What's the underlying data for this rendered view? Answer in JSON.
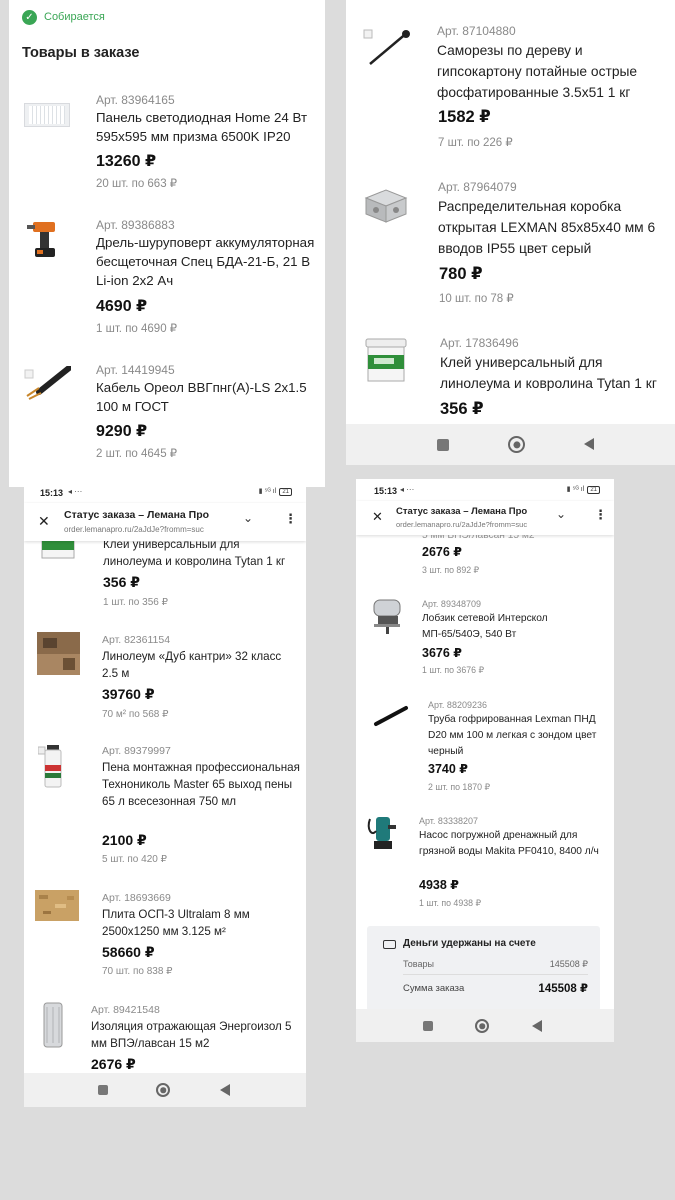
{
  "p1": {
    "status": "Собирается",
    "section_title": "Товары в заказе",
    "items": [
      {
        "art": "Арт. 83964165",
        "name": "Панель светодиодная Home 24 Вт 595x595 мм призма 6500K IP20",
        "price": "13260 ₽",
        "qty": "20 шт. по 663 ₽"
      },
      {
        "art": "Арт. 89386883",
        "name": "Дрель-шуруповерт аккумуляторная бесщеточная Спец БДА-21-Б, 21 В Li-ion 2x2 Ач",
        "price": "4690 ₽",
        "qty": "1 шт. по 4690 ₽"
      },
      {
        "art": "Арт. 14419945",
        "name": "Кабель Ореол ВВГпнг(А)-LS 2x1.5 100 м ГОСТ",
        "price": "9290 ₽",
        "qty": "2 шт. по 4645 ₽"
      }
    ]
  },
  "p2": {
    "items": [
      {
        "art": "Арт. 87104880",
        "name": "Саморезы по дереву и гипсокартону потайные острые фосфатированные 3.5x51 1 кг",
        "price": "1582 ₽",
        "qty": "7 шт. по 226 ₽"
      },
      {
        "art": "Арт. 87964079",
        "name": "Распределительная коробка открытая LEXMAN 85x85x40 мм 6 вводов IP55 цвет серый",
        "price": "780 ₽",
        "qty": "10 шт. по 78 ₽"
      },
      {
        "art": "Арт. 17836496",
        "name": "Клей универсальный для линолеума и ковролина Tytan 1 кг",
        "price": "356 ₽",
        "qty": ""
      }
    ]
  },
  "browser": {
    "time": "15:13",
    "status_icons": "◂ ···",
    "signal": "▮ ⁵ᴳ ıl",
    "battery": "21",
    "title": "Статус заказа – Лемана Про",
    "url": "order.lemanapro.ru/2aJdJe?fromm=suc"
  },
  "p3": {
    "top_name": "Клей универсальный для линолеума и ковролина Tytan 1 кг",
    "top_price": "356 ₽",
    "top_qty": "1 шт. по 356 ₽",
    "items": [
      {
        "art": "Арт. 82361154",
        "name": "Линолеум «Дуб кантри» 32 класс 2.5 м",
        "price": "39760 ₽",
        "qty": "70 м² по 568 ₽"
      },
      {
        "art": "Арт. 89379997",
        "name": "Пена монтажная профессиональная Технониколь Master 65 выход пены 65 л всесезонная 750 мл",
        "price": "2100 ₽",
        "qty": "5 шт. по 420 ₽"
      },
      {
        "art": "Арт. 18693669",
        "name": "Плита ОСП-3 Ultralam 8 мм 2500x1250 мм 3.125 м²",
        "price": "58660 ₽",
        "qty": "70 шт. по 838 ₽"
      },
      {
        "art": "Арт. 89421548",
        "name": "Изоляция отражающая Энергоизол 5 мм ВПЭ/лавсан 15 м2",
        "price": "2676 ₽",
        "qty": ""
      }
    ]
  },
  "p4": {
    "top_name": "5 мм ВПЭ/лавсан 15 м2",
    "top_price": "2676 ₽",
    "top_qty": "3 шт. по 892 ₽",
    "items": [
      {
        "art": "Арт. 89348709",
        "name": "Лобзик сетевой Интерскол МП-65/540Э, 540 Вт",
        "price": "3676 ₽",
        "qty": "1 шт. по 3676 ₽"
      },
      {
        "art": "Арт. 88209236",
        "name": "Труба гофрированная Lexman ПНД D20 мм 100 м легкая с зондом цвет черный",
        "price": "3740 ₽",
        "qty": "2 шт. по 1870 ₽"
      },
      {
        "art": "Арт. 83338207",
        "name": "Насос погружной дренажный для грязной воды Makita PF0410, 8400 л/ч",
        "price": "4938 ₽",
        "qty": "1 шт. по 4938 ₽"
      }
    ],
    "summary": {
      "title": "Деньги удержаны на счете",
      "goods_label": "Товары",
      "goods_value": "145508 ₽",
      "total_label": "Сумма заказа",
      "total_value": "145508 ₽"
    }
  },
  "colors": {
    "accent_green": "#3aa655",
    "background": "#dcdcdc"
  }
}
